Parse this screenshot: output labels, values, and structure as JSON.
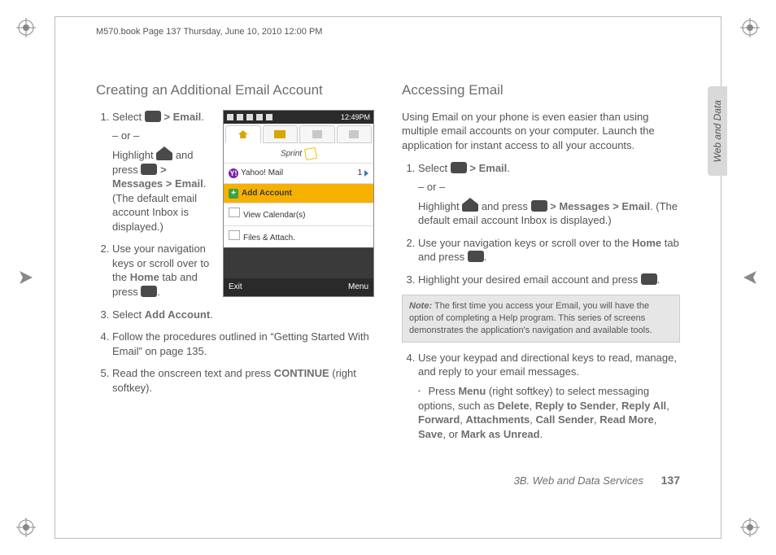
{
  "imprint": "M570.book  Page 137  Thursday, June 10, 2010  12:00 PM",
  "sidetab": "Web and Data",
  "footer": {
    "section": "3B. Web and Data Services",
    "page": "137"
  },
  "left": {
    "heading": "Creating an Additional Email Account",
    "s1a": "Select ",
    "s1b": "Email",
    "s1c": ".",
    "or": "– or –",
    "s1d": "Highlight ",
    "s1e": " and press ",
    "s1f": "Messages",
    "s1g": "Email",
    "s1h": ". (The default email account Inbox is displayed.)",
    "s2a": "Use your navigation keys or scroll over to the ",
    "s2b": "Home",
    "s2c": " tab and press ",
    "s2d": ".",
    "s3a": "Select ",
    "s3b": "Add Account",
    "s3c": ".",
    "s4": "Follow the procedures outlined in “Getting Started With Email” on page 135.",
    "s5a": "Read the onscreen text and press ",
    "s5b": "CONTINUE",
    "s5c": " (right softkey)."
  },
  "phone": {
    "time": "12:49PM",
    "carrier": "Sprint",
    "yahoo": "Yahoo! Mail",
    "yahoo_count": "1",
    "add": "Add Account",
    "calendar": "View Calendar(s)",
    "files": "Files & Attach.",
    "soft_left": "Exit",
    "soft_right": "Menu"
  },
  "right": {
    "heading": "Accessing Email",
    "intro": "Using Email on your phone is even easier than using multiple email accounts on your computer. Launch the application for instant access to all your accounts.",
    "s1a": "Select ",
    "s1b": "Email",
    "s1c": ".",
    "or": "– or –",
    "s1d": "Highlight ",
    "s1e": " and press ",
    "s1f": "Messages",
    "s1g": "Email",
    "s1h": ". (The default email account Inbox is displayed.)",
    "s2a": "Use your navigation keys or scroll over to the ",
    "s2b": "Home",
    "s2c": " tab and press ",
    "s2d": ".",
    "s3a": "Highlight your desired email account and press ",
    "s3b": ".",
    "note_label": "Note:",
    "note_body": "The first time you access your Email, you will have the option of completing a Help program. This series of screens demonstrates the application's navigation and available tools.",
    "s4": "Use your keypad and directional keys to read, manage, and reply to your email messages.",
    "sub_a": "Press ",
    "sub_menu": "Menu",
    "sub_b": " (right softkey) to select messaging options, such as ",
    "opt1": "Delete",
    "opt2": "Reply to Sender",
    "opt3": "Reply All",
    "opt4": "Forward",
    "opt5": "Attachments",
    "opt6": "Call Sender",
    "opt7": "Read More",
    "opt8": "Save",
    "or_word": ", or ",
    "opt9": "Mark as Unread",
    "period": "."
  }
}
